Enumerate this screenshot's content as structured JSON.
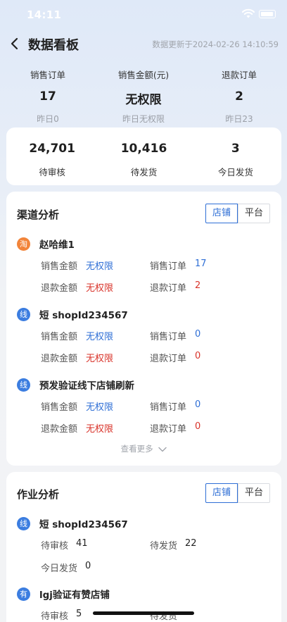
{
  "status_bar": {
    "time": "14:11"
  },
  "nav": {
    "title": "数据看板",
    "update_text": "数据更新于2024-02-26 14:10:59"
  },
  "top_stats": [
    {
      "label": "销售订单",
      "value": "17",
      "sub": "昨日0"
    },
    {
      "label": "销售金额(元)",
      "value": "无权限",
      "sub": "昨日无权限"
    },
    {
      "label": "退款订单",
      "value": "2",
      "sub": "昨日23"
    }
  ],
  "summary": [
    {
      "value": "24,701",
      "label": "待审核"
    },
    {
      "value": "10,416",
      "label": "待发货"
    },
    {
      "value": "3",
      "label": "今日发货"
    }
  ],
  "channel": {
    "title": "渠道分析",
    "toggle": [
      "店铺",
      "平台"
    ],
    "shops": [
      {
        "badge": "淘",
        "name": "赵哈维1",
        "sales_amount_label": "销售金额",
        "sales_amount": "无权限",
        "sales_orders_label": "销售订单",
        "sales_orders": "17",
        "refund_amount_label": "退款金额",
        "refund_amount": "无权限",
        "refund_orders_label": "退款订单",
        "refund_orders": "2"
      },
      {
        "badge": "线",
        "name": "短 shopId234567",
        "sales_amount_label": "销售金额",
        "sales_amount": "无权限",
        "sales_orders_label": "销售订单",
        "sales_orders": "0",
        "refund_amount_label": "退款金额",
        "refund_amount": "无权限",
        "refund_orders_label": "退款订单",
        "refund_orders": "0"
      },
      {
        "badge": "线",
        "name": "预发验证线下店铺刷新",
        "sales_amount_label": "销售金额",
        "sales_amount": "无权限",
        "sales_orders_label": "销售订单",
        "sales_orders": "0",
        "refund_amount_label": "退款金额",
        "refund_amount": "无权限",
        "refund_orders_label": "退款订单",
        "refund_orders": "0"
      }
    ],
    "more": "查看更多"
  },
  "operation": {
    "title": "作业分析",
    "toggle": [
      "店铺",
      "平台"
    ],
    "shops": [
      {
        "badge": "线",
        "name": "短 shopId234567",
        "pending_review_label": "待审核",
        "pending_review": "41",
        "pending_ship_label": "待发货",
        "pending_ship": "22",
        "today_ship_label": "今日发货",
        "today_ship": "0"
      },
      {
        "badge": "有",
        "name": "lgj验证有赞店铺",
        "pending_review_label": "待审核",
        "pending_review": "5",
        "pending_ship_label": "待发货"
      }
    ]
  },
  "colors": {
    "accent": "#2f6fd6",
    "danger": "#d9342b",
    "taobao": "#f2843a",
    "offline": "#3b7de0"
  }
}
